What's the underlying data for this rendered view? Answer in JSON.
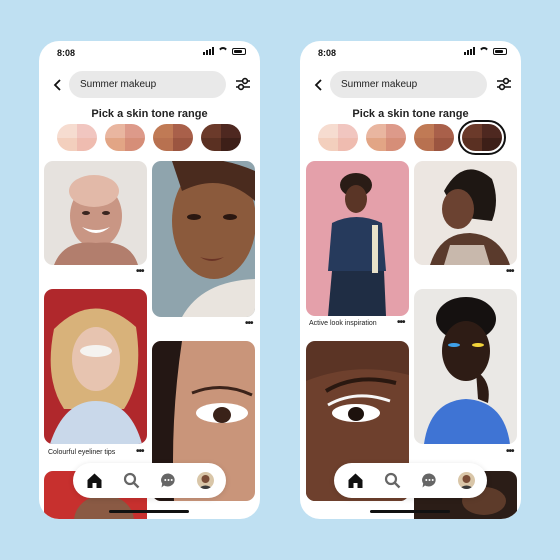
{
  "screens": [
    {
      "status_time": "8:08",
      "search_value": "Summer makeup",
      "skin_title": "Pick a skin tone range",
      "selected_swatch": 0,
      "captions": [
        "Colourful eyeliner tips"
      ],
      "tabs": [
        "home-icon",
        "search-icon",
        "messages-icon",
        "profile-avatar"
      ]
    },
    {
      "status_time": "8:08",
      "search_value": "Summer makeup",
      "skin_title": "Pick a skin tone range",
      "selected_swatch": 4,
      "captions": [
        "Active look inspiration"
      ],
      "tabs": [
        "home-icon",
        "search-icon",
        "messages-icon",
        "profile-avatar"
      ]
    }
  ],
  "swatches": [
    [
      "#f6dcd0",
      "#f1c6c0",
      "#f3cfbd",
      "#efbcb0"
    ],
    [
      "#e9b6a0",
      "#dd9a8a",
      "#e2a585",
      "#d68e78"
    ],
    [
      "#c07a55",
      "#a9604a",
      "#b87150",
      "#9b5540"
    ],
    [
      "#6b3a2a",
      "#4e2820",
      "#5a3022",
      "#3d1f18"
    ]
  ],
  "colors": {
    "background": "#bfe0f2",
    "phone": "#ffffff",
    "search_bg": "#e9e9e9",
    "text": "#222222"
  }
}
